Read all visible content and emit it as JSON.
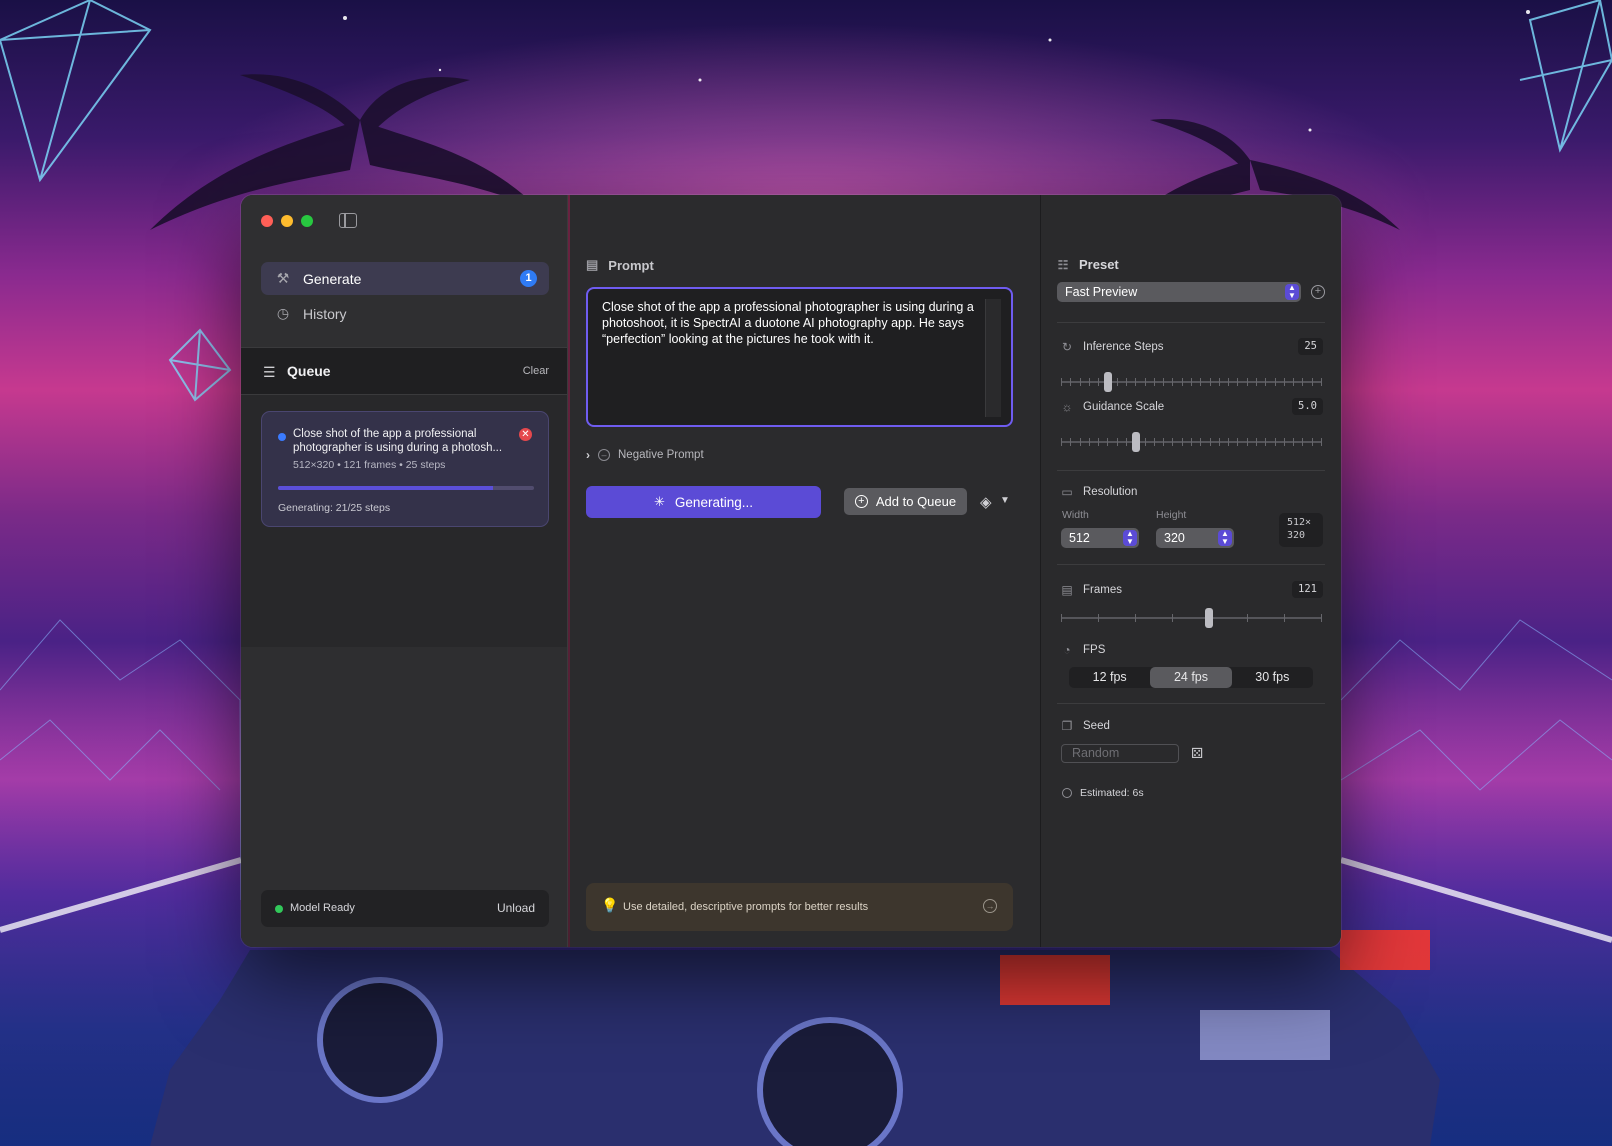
{
  "window": {
    "sidebar": {
      "nav": [
        {
          "label": "Generate",
          "icon": "magic-wand-icon",
          "badge": "1",
          "active": true
        },
        {
          "label": "History",
          "icon": "clock-history-icon",
          "active": false
        }
      ],
      "queue": {
        "title": "Queue",
        "clear_label": "Clear",
        "item": {
          "text": "Close shot of the app a professional photographer is using during a photosh...",
          "meta": "512×320  •  121 frames  •  25 steps",
          "progress": 0.84,
          "status": "Generating: 21/25 steps"
        }
      },
      "model": {
        "status": "Model Ready",
        "unload_label": "Unload"
      }
    },
    "main": {
      "prompt_title": "Prompt",
      "prompt_text": "Close shot of the app a professional photographer is using during a photoshoot, it is SpectrAI a duotone AI photography app. He says “perfection” looking at the pictures he took with it.",
      "negative_prompt_label": "Negative Prompt",
      "generate_label": "Generating...",
      "add_queue_label": "Add to Queue",
      "tip_text": "Use detailed, descriptive prompts for better results"
    },
    "panel": {
      "preset_title": "Preset",
      "preset_value": "Fast Preview",
      "inference": {
        "label": "Inference Steps",
        "value": "25",
        "fraction": 0.18
      },
      "guidance": {
        "label": "Guidance Scale",
        "value": "5.0",
        "fraction": 0.29
      },
      "resolution": {
        "label": "Resolution",
        "width_label": "Width",
        "height_label": "Height",
        "width": "512",
        "height": "320",
        "readout_line1": "512×",
        "readout_line2": "320"
      },
      "frames": {
        "label": "Frames",
        "value": "121",
        "fraction": 0.57
      },
      "fps": {
        "label": "FPS",
        "options": [
          "12 fps",
          "24 fps",
          "30 fps"
        ],
        "selected": "24 fps"
      },
      "seed": {
        "label": "Seed",
        "placeholder": "Random"
      },
      "estimated": "Estimated: 6s"
    }
  },
  "colors": {
    "accent": "#5b4bd6",
    "badge": "#2f7bf5",
    "ready": "#32c85a",
    "close": "#e5484d"
  }
}
